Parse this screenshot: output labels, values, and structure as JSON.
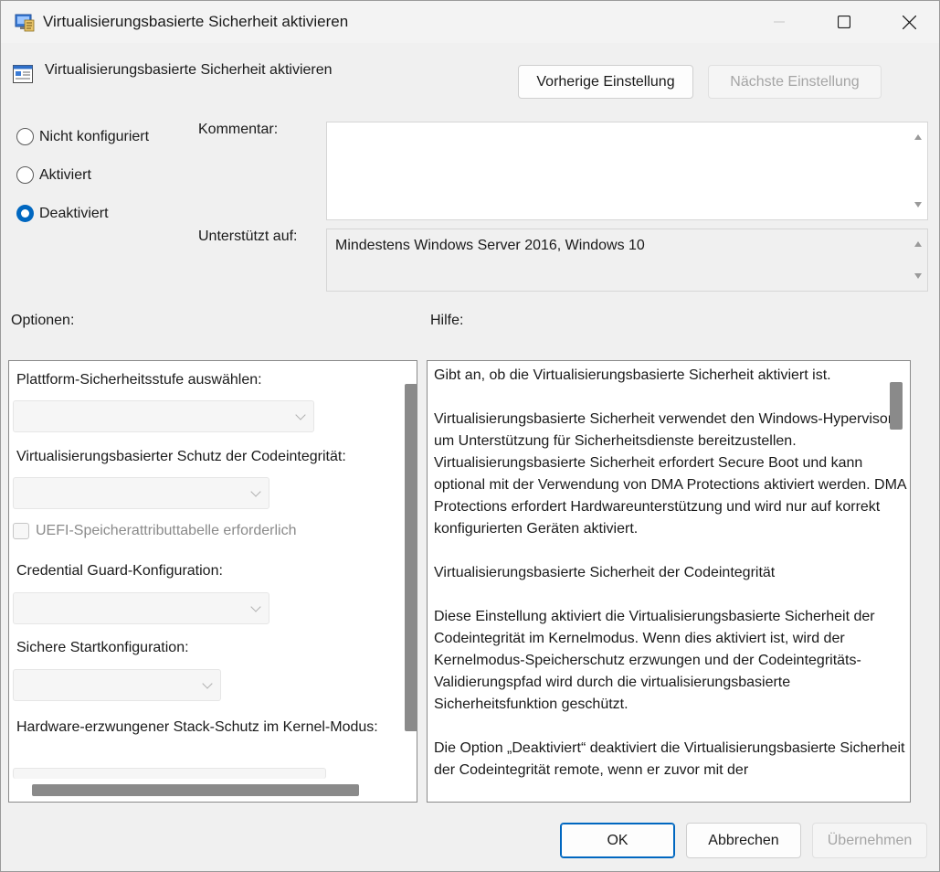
{
  "window": {
    "title": "Virtualisierungsbasierte Sicherheit aktivieren",
    "icons": {
      "app": "group-policy-editor-icon",
      "minimize": "minimize-icon",
      "maximize": "maximize-icon",
      "close": "close-icon"
    }
  },
  "header": {
    "policy_title": "Virtualisierungsbasierte Sicherheit aktivieren",
    "prev_button": "Vorherige Einstellung",
    "next_button": "Nächste Einstellung"
  },
  "state": {
    "options": [
      {
        "label": "Nicht konfiguriert",
        "checked": false
      },
      {
        "label": "Aktiviert",
        "checked": false
      },
      {
        "label": "Deaktiviert",
        "checked": true
      }
    ]
  },
  "comment": {
    "label": "Kommentar:",
    "value": ""
  },
  "supported": {
    "label": "Unterstützt auf:",
    "value": "Mindestens Windows Server 2016, Windows 10"
  },
  "options_section": {
    "label": "Optionen:",
    "items": {
      "platform_label": "Plattform-Sicherheitsstufe auswählen:",
      "codeint_label": "Virtualisierungsbasierter Schutz der Codeintegrität:",
      "uefi_checkbox": "UEFI-Speicherattributtabelle erforderlich",
      "credguard_label": "Credential Guard-Konfiguration:",
      "secureboot_label": "Sichere Startkonfiguration:",
      "stack_label": "Hardware-erzwungener Stack-Schutz im Kernel-Modus:"
    }
  },
  "help_section": {
    "label": "Hilfe:",
    "paragraphs": [
      "Gibt an, ob die Virtualisierungsbasierte Sicherheit aktiviert ist.",
      "Virtualisierungsbasierte Sicherheit verwendet den Windows-Hypervisor, um Unterstützung für Sicherheitsdienste bereitzustellen. Virtualisierungsbasierte Sicherheit erfordert Secure Boot und kann optional mit der Verwendung von DMA Protections aktiviert werden. DMA Protections erfordert Hardwareunterstützung und wird nur auf korrekt konfigurierten Geräten aktiviert.",
      "Virtualisierungsbasierte Sicherheit der Codeintegrität",
      "Diese Einstellung aktiviert die Virtualisierungsbasierte Sicherheit der Codeintegrität im Kernelmodus. Wenn dies aktiviert ist, wird der Kernelmodus-Speicherschutz erzwungen und der Codeintegritäts-Validierungspfad wird durch die virtualisierungsbasierte Sicherheitsfunktion geschützt.",
      "Die Option „Deaktiviert“ deaktiviert die Virtualisierungsbasierte Sicherheit der Codeintegrität remote, wenn er zuvor mit der"
    ]
  },
  "footer": {
    "ok": "OK",
    "cancel": "Abbrechen",
    "apply": "Übernehmen"
  },
  "colors": {
    "accent": "#0067c0",
    "disabled_text": "#a5a5a5"
  }
}
